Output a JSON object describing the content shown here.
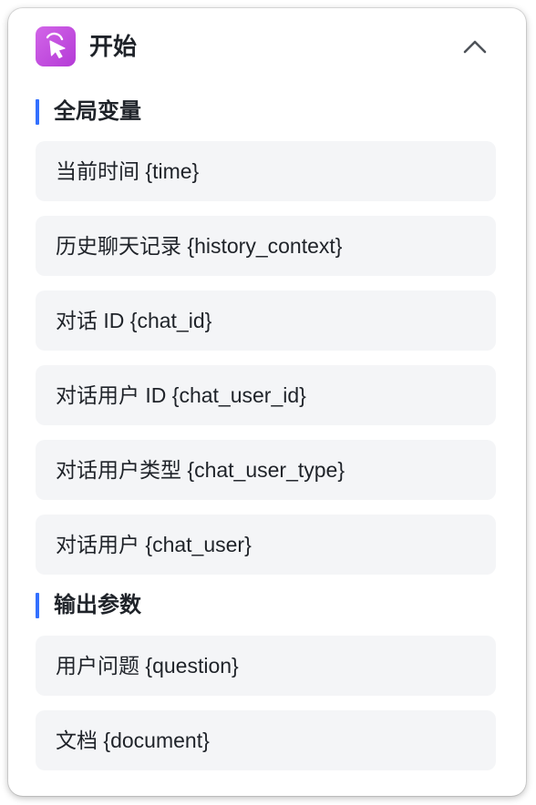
{
  "header": {
    "title": "开始",
    "icon": "cursor-click-icon",
    "collapse_icon": "chevron-up-icon",
    "accent": "#c44fe0"
  },
  "sections": [
    {
      "title": "全局变量",
      "items": [
        {
          "label": "当前时间 {time}"
        },
        {
          "label": "历史聊天记录 {history_context}"
        },
        {
          "label": "对话 ID {chat_id}"
        },
        {
          "label": "对话用户 ID {chat_user_id}"
        },
        {
          "label": "对话用户类型 {chat_user_type}"
        },
        {
          "label": "对话用户 {chat_user}"
        }
      ]
    },
    {
      "title": "输出参数",
      "items": [
        {
          "label": "用户问题 {question}"
        },
        {
          "label": "文档 {document}"
        }
      ]
    }
  ],
  "colors": {
    "section_bar": "#3370ff",
    "item_bg": "#f4f5f7",
    "text": "#1f2329"
  }
}
